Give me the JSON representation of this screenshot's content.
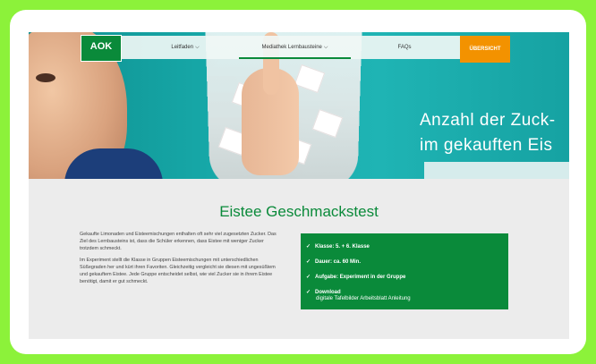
{
  "nav": {
    "logo": "AOK",
    "items": [
      {
        "label": "Leitfaden"
      },
      {
        "label": "Mediathek Lernbausteine"
      },
      {
        "label": "FAQs"
      }
    ],
    "cta": "ÜBERSICHT"
  },
  "hero": {
    "caption_line1": "Anzahl der Zuck-",
    "caption_line2": "im gekauften Eis"
  },
  "main": {
    "title": "Eistee Geschmackstest",
    "paragraph1": "Gekaufte Limonaden und Eisteemischungen enthalten oft sehr viel zugesetzten Zucker. Das Ziel des Lernbausteins ist, dass die Schüler erkennen, dass Eistee mit weniger Zucker trotzdem schmeckt.",
    "paragraph2": "Im Experiment stellt die Klasse in Gruppen Eisteemischungen mit unterschiedlichen Süßegraden her und kürt ihren Favoriten. Gleichzeitig vergleicht sie diesen mit ungesüßtem und gekauftem Eistee. Jede Gruppe entscheidet selbst, wie viel Zucker sie in ihrem Eistee benötigt, damit er gut schmeckt."
  },
  "info": {
    "items": [
      "Klasse: 5. + 6. Klasse",
      "Dauer: ca. 60 Min.",
      "Aufgabe: Experiment in der Gruppe",
      "Download"
    ],
    "download_links": "digitale Tafelbilder Arbeitsblatt Anleitung"
  },
  "colors": {
    "brand_green": "#0a8a3a",
    "accent_orange": "#f39200",
    "hero_teal": "#17a9a9",
    "frame_bg": "#8cf23a"
  },
  "icons": {
    "check": "check-icon",
    "chevron": "chevron-down-icon"
  }
}
